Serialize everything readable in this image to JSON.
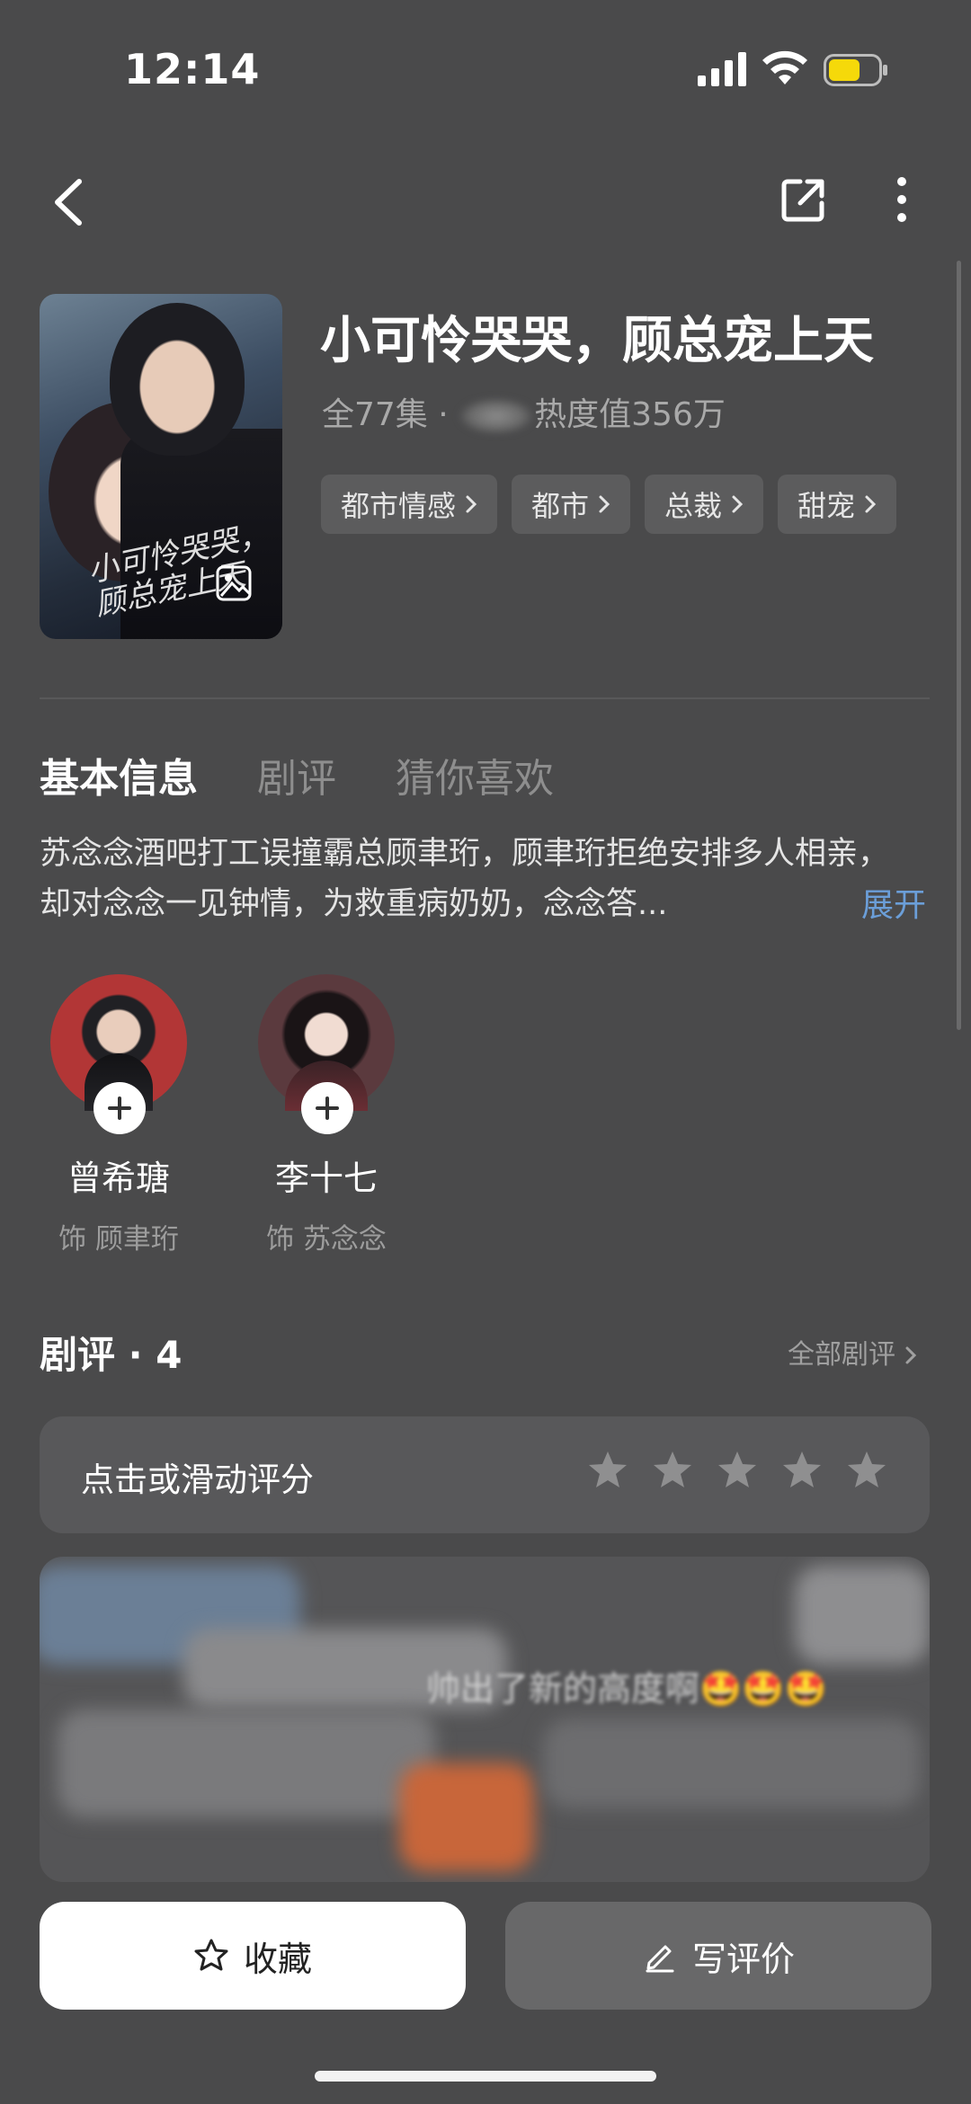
{
  "status_bar": {
    "time": "12:14"
  },
  "drama": {
    "title": "小可怜哭哭，顾总宠上天",
    "episodes": "全77集 · ",
    "heat": "热度值356万",
    "tags": [
      "都市情感",
      "都市",
      "总裁",
      "甜宠"
    ],
    "cover_title": "小可怜哭哭，顾总宠上天"
  },
  "tabs": {
    "info": "基本信息",
    "reviews": "剧评",
    "recommend": "猜你喜欢"
  },
  "synopsis": {
    "text": "苏念念酒吧打工误撞霸总顾聿珩，顾聿珩拒绝安排多人相亲，却对念念一见钟情，为救重病奶奶，念念答...",
    "expand": "展开"
  },
  "cast": [
    {
      "name": "曾希瑭",
      "role": "饰 顾聿珩"
    },
    {
      "name": "李十七",
      "role": "饰 苏念念"
    }
  ],
  "reviews": {
    "header": "剧评 · 4",
    "all_link": "全部剧评",
    "rating_prompt": "点击或滑动评分",
    "rating_value": 0,
    "rating_max": 5,
    "preview_text": "帅出了新的高度啊🤩🤩🤩"
  },
  "actions": {
    "favorite": "收藏",
    "write_review": "写评价"
  },
  "colors": {
    "background": "#4a4a4b",
    "link": "#6b9ed8",
    "card": "#58585a"
  }
}
